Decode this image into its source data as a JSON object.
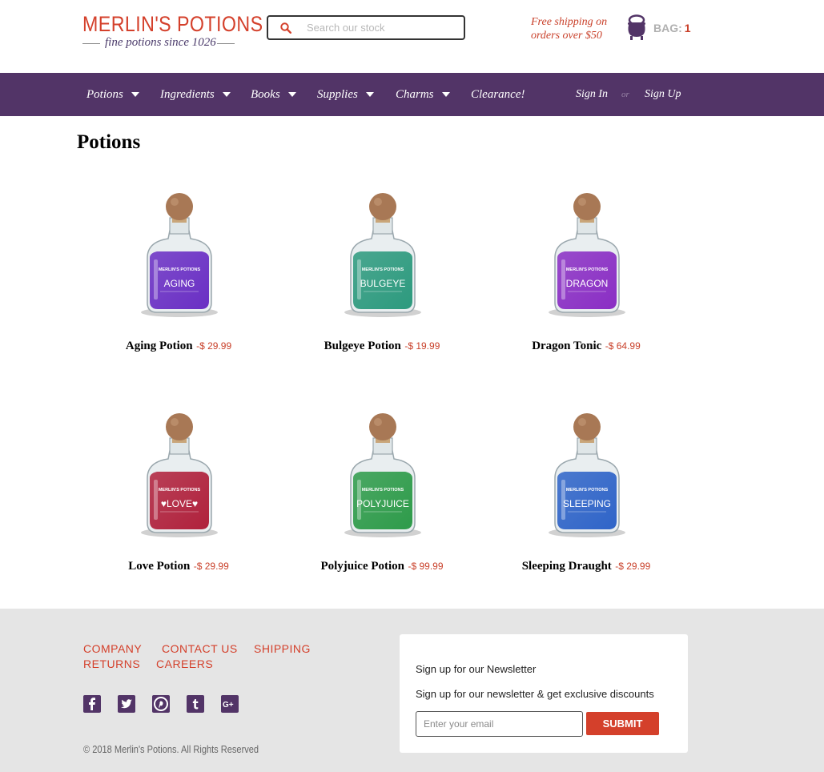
{
  "header": {
    "logo_title": "MERLIN'S POTIONS",
    "logo_tagline": "fine potions since 1026",
    "search_placeholder": "Search our stock",
    "search_value": "",
    "shipping_line1": "Free shipping on",
    "shipping_line2": "orders over $50",
    "bag_label": "BAG:",
    "bag_count": "1"
  },
  "nav": {
    "items": [
      {
        "label": "Potions",
        "dropdown": true
      },
      {
        "label": "Ingredients",
        "dropdown": true
      },
      {
        "label": "Books",
        "dropdown": true
      },
      {
        "label": "Supplies",
        "dropdown": true
      },
      {
        "label": "Charms",
        "dropdown": true
      },
      {
        "label": "Clearance!",
        "dropdown": false
      }
    ],
    "sign_in": "Sign In",
    "separator": "or",
    "sign_up": "Sign Up"
  },
  "main": {
    "title": "Potions",
    "products": [
      {
        "name": "Aging Potion",
        "price": "-$ 29.99",
        "label_text": "AGING",
        "liquid_color": "#6a2fc4"
      },
      {
        "name": "Bulgeye Potion",
        "price": "-$ 19.99",
        "label_text": "BULGEYE",
        "liquid_color": "#2d9a7e"
      },
      {
        "name": "Dragon Tonic",
        "price": "-$ 64.99",
        "label_text": "DRAGON",
        "liquid_color": "#8a2ec4"
      },
      {
        "name": "Love Potion",
        "price": "-$ 29.99",
        "label_text": "♥LOVE♥",
        "liquid_color": "#b0213c"
      },
      {
        "name": "Polyjuice Potion",
        "price": "-$ 99.99",
        "label_text": "POLYJUICE",
        "liquid_color": "#2e9b4a"
      },
      {
        "name": "Sleeping Draught",
        "price": "-$ 29.99",
        "label_text": "SLEEPING",
        "liquid_color": "#2f64c8"
      }
    ],
    "bottle_brand": "MERLIN'S POTIONS"
  },
  "footer": {
    "links": [
      "COMPANY",
      "CONTACT US",
      "SHIPPING",
      "RETURNS",
      "CAREERS"
    ],
    "social": [
      "facebook-icon",
      "twitter-icon",
      "pinterest-icon",
      "tumblr-icon",
      "google-plus-icon"
    ],
    "copyright": "© 2018 Merlin's Potions. All Rights Reserved",
    "newsletter": {
      "title": "Sign up for our Newsletter",
      "subtitle": "Sign up for our newsletter & get exclusive discounts",
      "placeholder": "Enter your email",
      "submit": "SUBMIT"
    }
  },
  "colors": {
    "brand_red": "#d4402b",
    "nav_purple": "#523467",
    "footer_bg": "#e5e5e5"
  }
}
